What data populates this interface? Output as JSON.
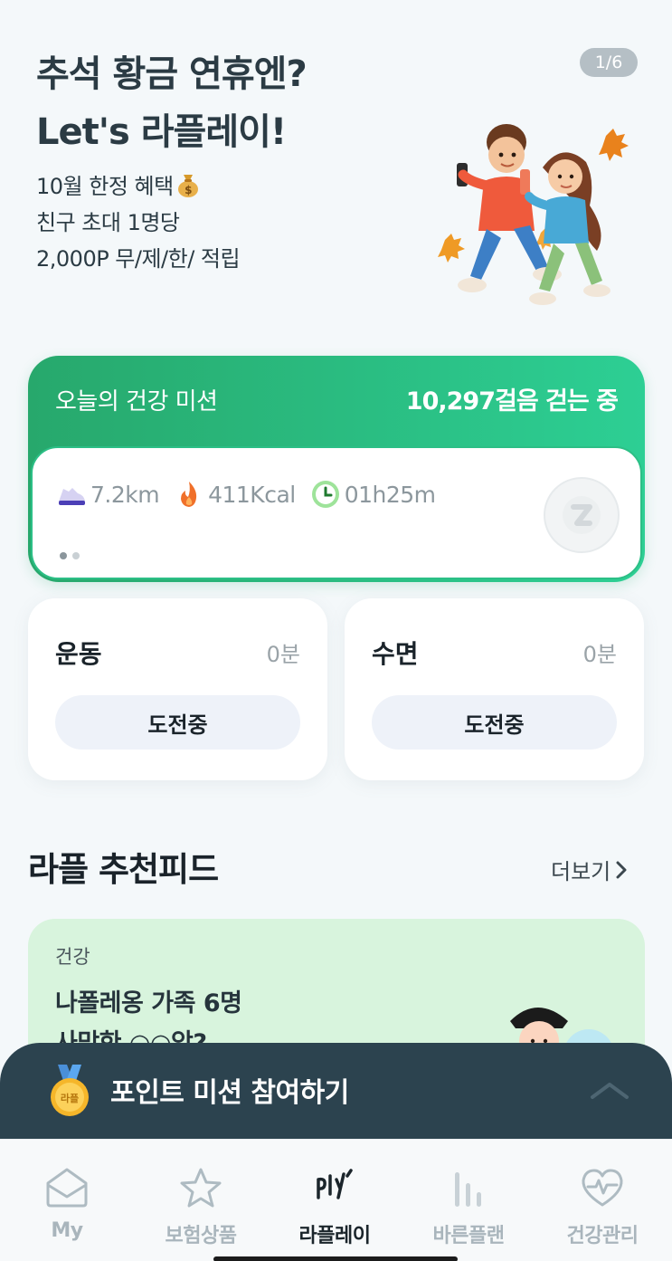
{
  "banner": {
    "title_line1": "추석 황금 연휴엔?",
    "title_line2": "Let's 라플레이!",
    "desc_line1": "10월 한정 혜택",
    "desc_line2": "친구 초대 1명당",
    "desc_line3": "2,000P 무/제/한/ 적립",
    "pager": "1/6"
  },
  "mission": {
    "label": "오늘의 건강 미션",
    "steps": "10,297걸음 걷는 중",
    "stats": [
      {
        "icon": "shoe-icon",
        "value": "7.2km"
      },
      {
        "icon": "flame-icon",
        "value": "411Kcal"
      },
      {
        "icon": "clock-icon",
        "value": "01h25m"
      }
    ]
  },
  "challenges": [
    {
      "title": "운동",
      "value": "0분",
      "button": "도전중"
    },
    {
      "title": "수면",
      "value": "0분",
      "button": "도전중"
    }
  ],
  "feed": {
    "title": "라플 추천피드",
    "more": "더보기",
    "card": {
      "category": "건강",
      "headline_line1": "나폴레옹 가족 6명",
      "headline_line2": "사망한 ○○암?"
    }
  },
  "point_sheet": {
    "label": "포인트 미션 참여하기",
    "medal_text": "라플"
  },
  "nav": [
    {
      "label": "My",
      "icon": "mailbox-icon"
    },
    {
      "label": "보험상품",
      "icon": "star-icon"
    },
    {
      "label": "라플레이",
      "icon": "play-logo-icon"
    },
    {
      "label": "바른플랜",
      "icon": "bars-icon"
    },
    {
      "label": "건강관리",
      "icon": "heart-pulse-icon"
    }
  ],
  "colors": {
    "mission_gradient_start": "#27a86c",
    "mission_gradient_end": "#2dcf94",
    "sheet_bg": "#2c434f",
    "feed_card_bg": "#d8f4dd"
  }
}
